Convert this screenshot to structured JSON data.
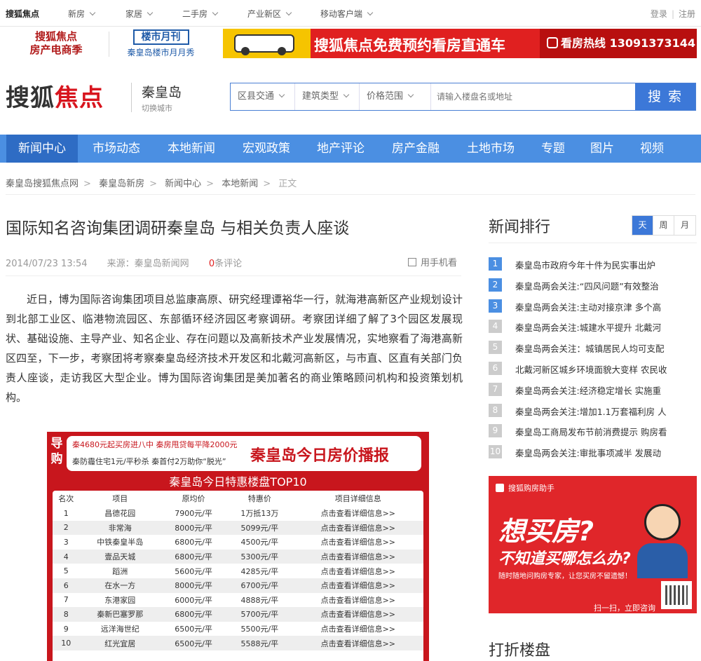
{
  "topbar": {
    "brand": "搜狐焦点",
    "menus": [
      "新房",
      "家居",
      "二手房",
      "产业新区",
      "移动客户端"
    ],
    "login": "登录",
    "register": "注册"
  },
  "banner": {
    "promo1_line1": "搜狐焦点",
    "promo1_line2": "房产电商季",
    "promo2_title": "楼市月刊",
    "promo2_sub": "秦皇岛楼市月月秀",
    "ad_main": "搜狐焦点免费预约看房直通车",
    "ad_hotline": "看房热线 13091373144"
  },
  "header": {
    "logo_black": "搜狐",
    "logo_red": "焦点",
    "city": "秦皇岛",
    "city_switch": "切换城市",
    "filters": [
      "区县交通",
      "建筑类型",
      "价格范围"
    ],
    "search_placeholder": "请输入楼盘名或地址",
    "search_button": "搜 索"
  },
  "nav": {
    "items": [
      "新闻中心",
      "市场动态",
      "本地新闻",
      "宏观政策",
      "地产评论",
      "房产金融",
      "土地市场",
      "专题",
      "图片",
      "视频"
    ],
    "active": "新闻中心"
  },
  "breadcrumb": [
    "秦皇岛搜狐焦点网",
    "秦皇岛新房",
    "新闻中心",
    "本地新闻",
    "正文"
  ],
  "article": {
    "title": "国际知名咨询集团调研秦皇岛 与相关负责人座谈",
    "date": "2014/07/23 13:54",
    "source": "来源：秦皇岛新闻网",
    "comment_count": "0",
    "comment_label": "条评论",
    "mobile_read": "用手机看",
    "body": "近日，博为国际咨询集团项目总监康高原、研究经理谭裕华一行，就海港高新区产业规划设计到北部工业区、临港物流园区、东部循环经济园区考察调研。考察团详细了解了3个园区发展现状、基础设施、主导产业、知名企业、存在问题以及高新技术产业发展情况，实地察看了海港高新区四至，下一步，考察团将考察秦皇岛经济技术开发区和北戴河高新区，与市直、区直有关部门负责人座谈，走访我区大型企业。博为国际咨询集团是美加著名的商业策略顾问机构和投资策划机构。"
  },
  "price_image": {
    "guide": "导购",
    "promo_line1": "秦4680元起买房进八中 秦房甩贷每平降2000元",
    "promo_line2": "秦防霾住宅1元/平秒杀 秦首付2万助你“脱光”",
    "big_title": "秦皇岛今日房价播报",
    "subtitle": "秦皇岛今日特惠楼盘TOP10",
    "headers": [
      "名次",
      "项目",
      "原均价",
      "特惠价",
      "项目详细信息"
    ],
    "rows": [
      [
        "1",
        "昌德花园",
        "7900元/平",
        "1万抵13万",
        "点击查看详细信息>>"
      ],
      [
        "2",
        "非常海",
        "8000元/平",
        "5099元/平",
        "点击查看详细信息>>"
      ],
      [
        "3",
        "中铁秦皇半岛",
        "6800元/平",
        "4500元/平",
        "点击查看详细信息>>"
      ],
      [
        "4",
        "壹品天城",
        "6800元/平",
        "5300元/平",
        "点击查看详细信息>>"
      ],
      [
        "5",
        "蹈洲",
        "5600元/平",
        "4285元/平",
        "点击查看详细信息>>"
      ],
      [
        "6",
        "在水一方",
        "8000元/平",
        "6700元/平",
        "点击查看详细信息>>"
      ],
      [
        "7",
        "东港家园",
        "6000元/平",
        "4888元/平",
        "点击查看详细信息>>"
      ],
      [
        "8",
        "秦新巴塞罗那",
        "6800元/平",
        "5700元/平",
        "点击查看详细信息>>"
      ],
      [
        "9",
        "远洋海世纪",
        "6500元/平",
        "5500元/平",
        "点击查看详细信息>>"
      ],
      [
        "10",
        "红光宜居",
        "6500元/平",
        "5588元/平",
        "点击查看详细信息>>"
      ]
    ]
  },
  "sidebar": {
    "rank_title": "新闻排行",
    "tabs": [
      "天",
      "周",
      "月"
    ],
    "active_tab": "天",
    "items": [
      "秦皇岛市政府今年十件为民实事出炉",
      "秦皇岛两会关注:“四风问题”有效整治",
      "秦皇岛两会关注:主动对接京津 多个高",
      "秦皇岛两会关注:城建水平提升 北戴河",
      "秦皇岛两会关注：城镇居民人均可支配",
      "北戴河新区城乡环境面貌大变样 农民收",
      "秦皇岛两会关注:经济稳定增长 实施重",
      "秦皇岛两会关注:增加1.1万套福利房 人",
      "秦皇岛工商局发布节前消费提示 购房看",
      "秦皇岛两会关注:审批事项减半 发展动"
    ],
    "ad": {
      "tag": "搜狐购房助手",
      "line1": "想买房?",
      "line2": "不知道买哪怎么办?",
      "small": "随时随地问购房专家，让您买房不留遗憾！",
      "scan": "扫一扫，立即咨询"
    },
    "discount_title": "打折楼盘"
  },
  "colors": {
    "nav_bg": "#4b8fe2",
    "nav_active": "#2e6cc4",
    "brand_red": "#d8151e",
    "search_blue": "#3c78d8"
  }
}
